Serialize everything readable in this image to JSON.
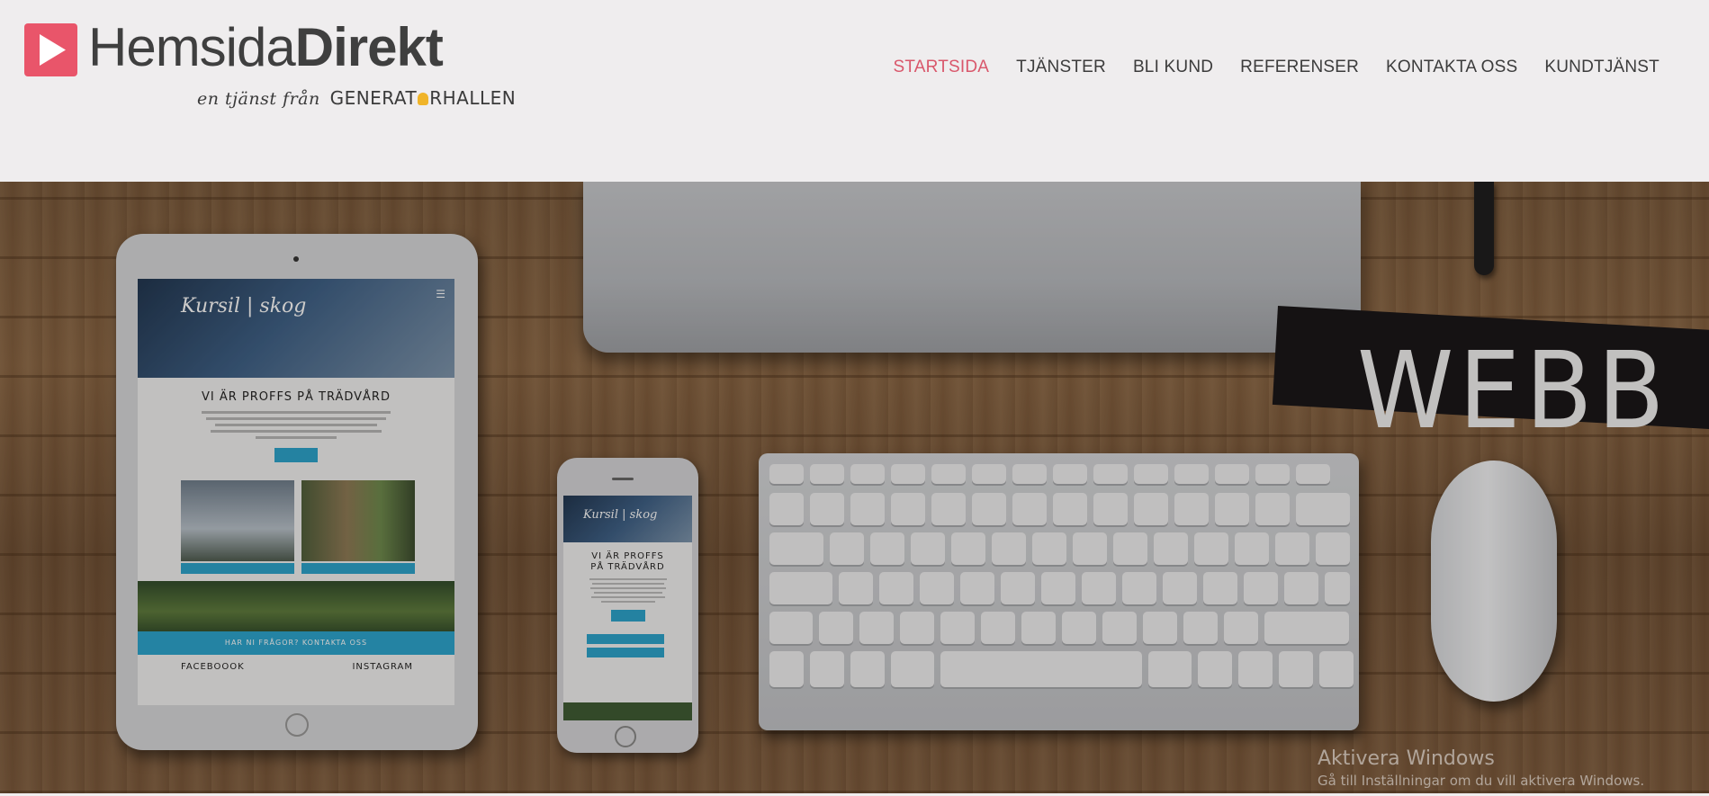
{
  "brand": {
    "name_light": "Hemsida",
    "name_bold": "Direkt",
    "tagline_script": "en tjänst från",
    "tagline_company_part1": "GENERAT",
    "tagline_company_part2": "RHALLEN",
    "accent_color": "#e9556a"
  },
  "nav": {
    "items": [
      {
        "label": "STARTSIDA",
        "active": true
      },
      {
        "label": "TJÄNSTER",
        "active": false
      },
      {
        "label": "BLI KUND",
        "active": false
      },
      {
        "label": "REFERENSER",
        "active": false
      },
      {
        "label": "KONTAKTA OSS",
        "active": false
      },
      {
        "label": "KUNDTJÄNST",
        "active": false
      }
    ],
    "active_color": "#d9576b"
  },
  "hero": {
    "heading": "WEBB",
    "tablet_site": {
      "logo": "Kursil | skog",
      "title": "VI ÄR PROFFS PÅ TRÄDVÅRD",
      "cta_bar": "HAR NI FRÅGOR? KONTAKTA OSS",
      "social_left": "FACEBOOOK",
      "social_right": "INSTAGRAM"
    },
    "phone_site": {
      "logo": "Kursil | skog",
      "title_line1": "VI ÄR PROFFS",
      "title_line2": "PÅ TRÄDVÅRD"
    }
  },
  "watermark": {
    "title": "Aktivera Windows",
    "subtitle": "Gå till Inställningar om du vill aktivera Windows."
  }
}
